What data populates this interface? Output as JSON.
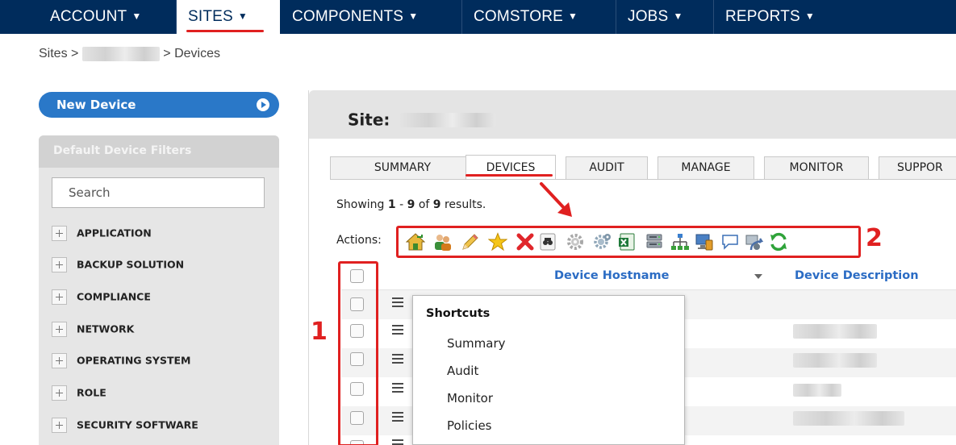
{
  "nav": {
    "items": [
      {
        "label": "ACCOUNT",
        "caret": "▼"
      },
      {
        "label": "SITES",
        "caret": "▼"
      },
      {
        "label": "COMPONENTS",
        "caret": "▼"
      },
      {
        "label": "COMSTORE",
        "caret": "▼"
      },
      {
        "label": "JOBS",
        "caret": "▼"
      },
      {
        "label": "REPORTS",
        "caret": "▼"
      }
    ],
    "active_index": 1
  },
  "breadcrumb": {
    "root": "Sites",
    "separator": ">",
    "current": "Devices"
  },
  "sidebar": {
    "new_device_label": "New Device",
    "filters_title": "Default Device Filters",
    "search_placeholder": "Search",
    "filters": [
      "APPLICATION",
      "BACKUP SOLUTION",
      "COMPLIANCE",
      "NETWORK",
      "OPERATING SYSTEM",
      "ROLE",
      "SECURITY SOFTWARE"
    ]
  },
  "site": {
    "title_prefix": "Site:"
  },
  "tabs": [
    {
      "label": "SUMMARY"
    },
    {
      "label": "DEVICES"
    },
    {
      "label": "AUDIT"
    },
    {
      "label": "MANAGE"
    },
    {
      "label": "MONITOR"
    },
    {
      "label": "SUPPOR"
    }
  ],
  "active_tab": "DEVICES",
  "results": {
    "prefix": "Showing",
    "start": "1",
    "dash": "-",
    "end": "9",
    "of": "of",
    "total": "9",
    "suffix": "results."
  },
  "actions": {
    "label": "Actions:",
    "icons": [
      "move-to-site-icon",
      "assign-users-icon",
      "edit-icon",
      "favorite-star-icon",
      "delete-icon",
      "audit-binoculars-icon",
      "settings-gear-icon",
      "settings-gears-icon",
      "export-excel-icon",
      "server-icon",
      "network-topology-icon",
      "monitor-device-icon",
      "message-bubble-icon",
      "remote-takeover-icon",
      "refresh-icon"
    ]
  },
  "annotations": {
    "checkbox_column_number": "1",
    "toolbar_number": "2"
  },
  "table": {
    "columns": [
      "Device Hostname",
      "Device Description"
    ],
    "row_count": 6
  },
  "shortcuts": {
    "title": "Shortcuts",
    "items": [
      "Summary",
      "Audit",
      "Monitor",
      "Policies"
    ]
  },
  "colors": {
    "nav_bg": "#002c5c",
    "accent_blue": "#2a78c8",
    "link_blue": "#2b6cc4",
    "annotation_red": "#e02020"
  }
}
